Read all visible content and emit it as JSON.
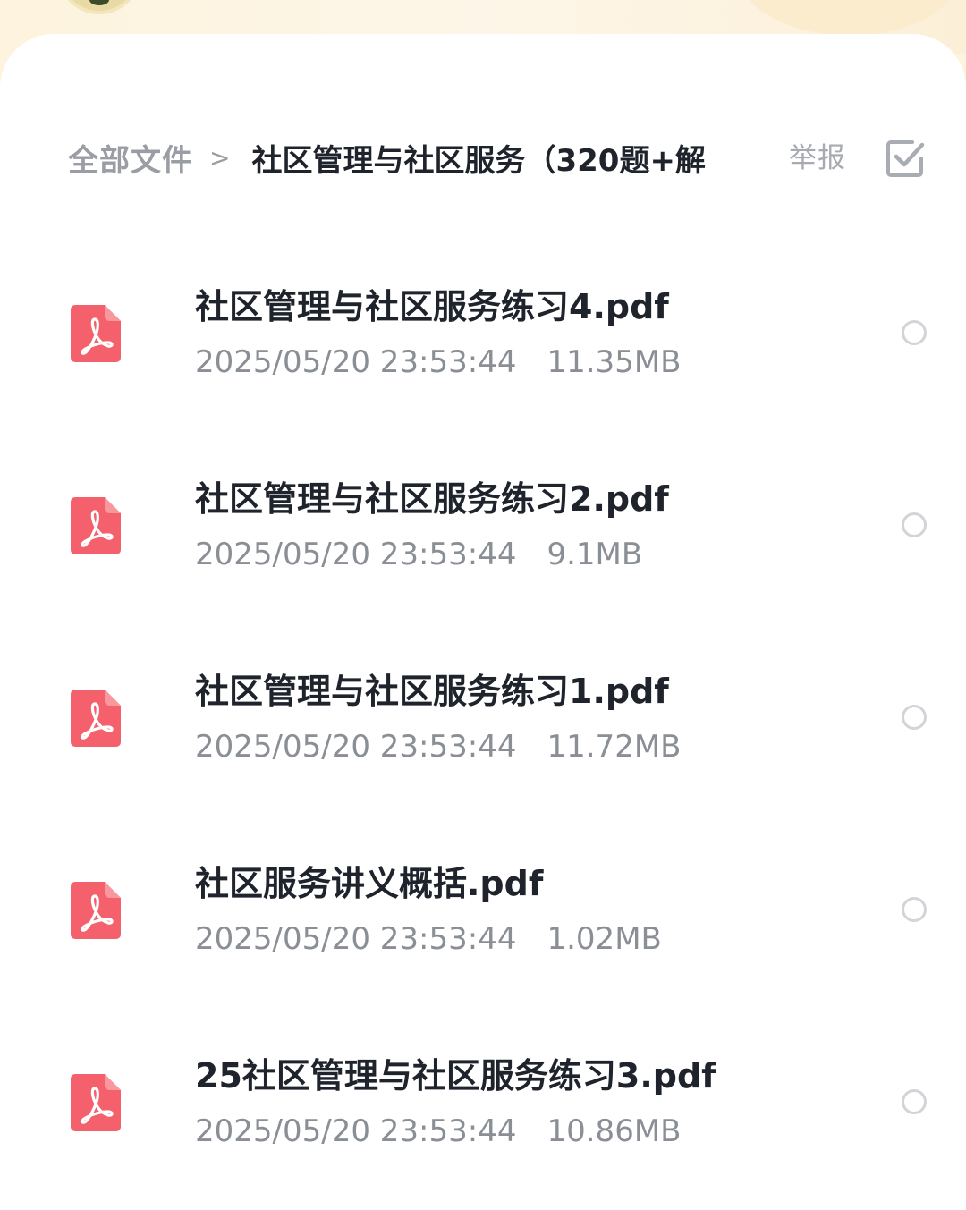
{
  "breadcrumb": {
    "root": "全部文件",
    "separator": ">",
    "current": "社区管理与社区服务（320题+解"
  },
  "toolbar": {
    "report_label": "举报",
    "select_icon": "checkbox-check-icon"
  },
  "colors": {
    "accent_pdf": "#f4606b",
    "title_text": "#1e232c",
    "meta_text": "#8a8e95",
    "muted_text": "#9a9da3"
  },
  "files": [
    {
      "name": "社区管理与社区服务练习4.pdf",
      "date": "2025/05/20 23:53:44",
      "size": "11.35MB",
      "icon": "pdf-icon"
    },
    {
      "name": "社区管理与社区服务练习2.pdf",
      "date": "2025/05/20 23:53:44",
      "size": "9.1MB",
      "icon": "pdf-icon"
    },
    {
      "name": "社区管理与社区服务练习1.pdf",
      "date": "2025/05/20 23:53:44",
      "size": "11.72MB",
      "icon": "pdf-icon"
    },
    {
      "name": "社区服务讲义概括.pdf",
      "date": "2025/05/20 23:53:44",
      "size": "1.02MB",
      "icon": "pdf-icon"
    },
    {
      "name": "25社区管理与社区服务练习3.pdf",
      "date": "2025/05/20 23:53:44",
      "size": "10.86MB",
      "icon": "pdf-icon"
    }
  ]
}
